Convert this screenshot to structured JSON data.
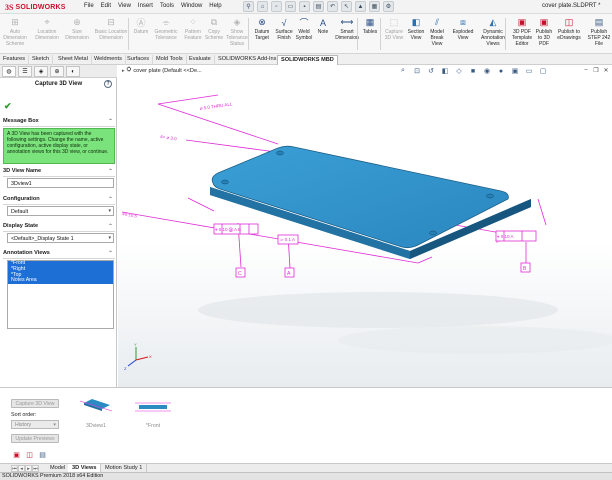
{
  "titlebar": {
    "logo_ds": "3S",
    "logo_text": "SOLIDWORKS",
    "menus": [
      "File",
      "Edit",
      "View",
      "Insert",
      "Tools",
      "Window",
      "Help"
    ],
    "document_title": "cover plate.SLDPRT *"
  },
  "commands": [
    {
      "label_lines": [
        "Auto",
        "Dimension",
        "Scheme"
      ],
      "icon": "auto-dimension-icon",
      "enabled": false
    },
    {
      "label_lines": [
        "Location",
        "Dimension"
      ],
      "icon": "location-dimension-icon",
      "enabled": false
    },
    {
      "label_lines": [
        "Size",
        "Dimension"
      ],
      "icon": "size-dimension-icon",
      "enabled": false
    },
    {
      "label_lines": [
        "Basic Location",
        "Dimension"
      ],
      "icon": "basic-location-dimension-icon",
      "enabled": false
    },
    {
      "label_lines": [
        "Datum"
      ],
      "icon": "datum-icon",
      "enabled": false
    },
    {
      "label_lines": [
        "Geometric",
        "Tolerance"
      ],
      "icon": "geometric-tolerance-icon",
      "enabled": false
    },
    {
      "label_lines": [
        "Pattern",
        "Feature"
      ],
      "icon": "pattern-feature-icon",
      "enabled": false
    },
    {
      "label_lines": [
        "Copy",
        "Scheme"
      ],
      "icon": "copy-scheme-icon",
      "enabled": false
    },
    {
      "label_lines": [
        "Show",
        "Tolerance",
        "Status"
      ],
      "icon": "show-tolerance-status-icon",
      "enabled": false
    },
    {
      "label_lines": [
        "Datum",
        "Target"
      ],
      "icon": "datum-target-icon",
      "enabled": true
    },
    {
      "label_lines": [
        "Surface",
        "Finish"
      ],
      "icon": "surface-finish-icon",
      "enabled": true
    },
    {
      "label_lines": [
        "Weld",
        "Symbol"
      ],
      "icon": "weld-symbol-icon",
      "enabled": true
    },
    {
      "label_lines": [
        "Note"
      ],
      "icon": "note-icon",
      "enabled": true
    },
    {
      "label_lines": [
        "Smart",
        "Dimension"
      ],
      "icon": "smart-dimension-icon",
      "enabled": true
    },
    {
      "label_lines": [
        "Tables"
      ],
      "icon": "tables-icon",
      "enabled": true
    },
    {
      "label_lines": [
        "Capture",
        "3D View"
      ],
      "icon": "capture-3d-view-icon",
      "enabled": false
    },
    {
      "label_lines": [
        "Section",
        "View"
      ],
      "icon": "section-view-icon",
      "enabled": true
    },
    {
      "label_lines": [
        "Model",
        "Break",
        "View"
      ],
      "icon": "model-break-view-icon",
      "enabled": true
    },
    {
      "label_lines": [
        "Exploded",
        "View"
      ],
      "icon": "exploded-view-icon",
      "enabled": true
    },
    {
      "label_lines": [
        "Dynamic",
        "Annotation",
        "Views"
      ],
      "icon": "dynamic-annotation-views-icon",
      "enabled": true
    },
    {
      "label_lines": [
        "3D PDF",
        "Template",
        "Editor"
      ],
      "icon": "3d-pdf-template-editor-icon",
      "enabled": true
    },
    {
      "label_lines": [
        "Publish",
        "to 3D",
        "PDF"
      ],
      "icon": "publish-3d-pdf-icon",
      "enabled": true
    },
    {
      "label_lines": [
        "Publish to",
        "eDrawings"
      ],
      "icon": "publish-edrawings-icon",
      "enabled": true
    },
    {
      "label_lines": [
        "Publish",
        "STEP 242",
        "File"
      ],
      "icon": "publish-step-242-icon",
      "enabled": true
    }
  ],
  "command_tabs": [
    {
      "label": "Features",
      "active": false
    },
    {
      "label": "Sketch",
      "active": false
    },
    {
      "label": "Sheet Metal",
      "active": false
    },
    {
      "label": "Weldments",
      "active": false
    },
    {
      "label": "Surfaces",
      "active": false
    },
    {
      "label": "Mold Tools",
      "active": false
    },
    {
      "label": "Evaluate",
      "active": false
    },
    {
      "label": "SOLIDWORKS Add-Ins",
      "active": false
    },
    {
      "label": "SOLIDWORKS MBD",
      "active": true
    }
  ],
  "property_manager": {
    "title": "Capture 3D View",
    "message_box": {
      "heading": "Message Box",
      "text": "A 3D View has been captured with the following settings. Change the name, active configuration, active display state, or annotation views for this 3D view, or continue."
    },
    "view_name": {
      "heading": "3D View Name",
      "value": "3Dview1"
    },
    "configuration": {
      "heading": "Configuration",
      "value": "Default"
    },
    "display_state": {
      "heading": "Display State",
      "value": "<Default>_Display State 1"
    },
    "annotation_views": {
      "heading": "Annotation Views",
      "items": [
        "*Front",
        "*Right",
        "*Top",
        "Notes Area"
      ]
    }
  },
  "graphics": {
    "tree_label": "cover plate  (Default <<De..."
  },
  "views_panel": {
    "capture_button": "Capture 3D View",
    "sort_label": "Sort order:",
    "sort_value": "History",
    "update_button": "Update Previews",
    "thumbnails": [
      "3Dview1",
      "*Front"
    ]
  },
  "model_tabs": [
    {
      "label": "Model",
      "active": false
    },
    {
      "label": "3D Views",
      "active": true
    },
    {
      "label": "Motion Study 1",
      "active": false
    }
  ],
  "status_bar": "SOLIDWORKS Premium 2018 x64 Edition",
  "colors": {
    "part": "#2b8cc4",
    "annotation": "#e02ad6",
    "message_box": "#7be37b",
    "selection": "#1d6fd6"
  }
}
